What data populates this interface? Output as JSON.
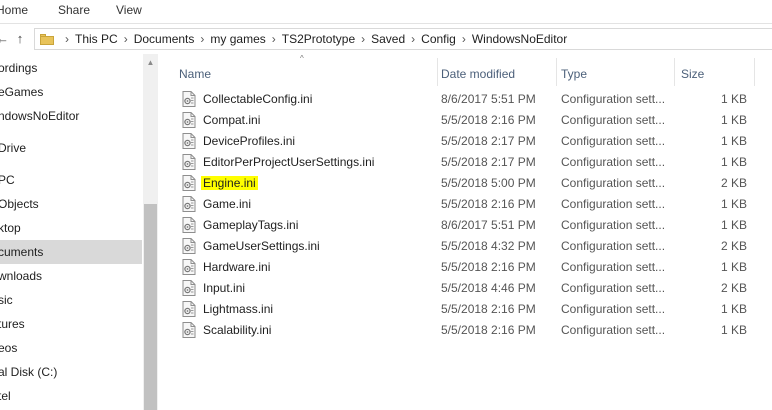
{
  "ribbon": {
    "tabs": [
      "Home",
      "Share",
      "View"
    ]
  },
  "nav": {
    "back_glyph": "←",
    "up_glyph": "↑"
  },
  "address": {
    "crumbs": [
      "This PC",
      "Documents",
      "my games",
      "TS2Prototype",
      "Saved",
      "Config",
      "WindowsNoEditor"
    ]
  },
  "sidebar": {
    "items": [
      {
        "label": "ordings",
        "selected": false
      },
      {
        "label": "eGames",
        "selected": false
      },
      {
        "label": "ndowsNoEditor",
        "selected": false
      },
      {
        "label": "Drive",
        "selected": false
      },
      {
        "label": "PC",
        "selected": false
      },
      {
        "label": "Objects",
        "selected": false
      },
      {
        "label": "ktop",
        "selected": false
      },
      {
        "label": "cuments",
        "selected": true
      },
      {
        "label": "wnloads",
        "selected": false
      },
      {
        "label": "sic",
        "selected": false
      },
      {
        "label": "tures",
        "selected": false
      },
      {
        "label": "eos",
        "selected": false
      },
      {
        "label": "al Disk (C:)",
        "selected": false
      },
      {
        "label": "tel",
        "selected": false
      }
    ]
  },
  "columns": {
    "name": "Name",
    "date": "Date modified",
    "type": "Type",
    "size": "Size"
  },
  "files": [
    {
      "name": "CollectableConfig.ini",
      "date": "8/6/2017 5:51 PM",
      "type": "Configuration sett...",
      "size": "1 KB",
      "highlighted": false
    },
    {
      "name": "Compat.ini",
      "date": "5/5/2018 2:16 PM",
      "type": "Configuration sett...",
      "size": "1 KB",
      "highlighted": false
    },
    {
      "name": "DeviceProfiles.ini",
      "date": "5/5/2018 2:17 PM",
      "type": "Configuration sett...",
      "size": "1 KB",
      "highlighted": false
    },
    {
      "name": "EditorPerProjectUserSettings.ini",
      "date": "5/5/2018 2:17 PM",
      "type": "Configuration sett...",
      "size": "1 KB",
      "highlighted": false
    },
    {
      "name": "Engine.ini",
      "date": "5/5/2018 5:00 PM",
      "type": "Configuration sett...",
      "size": "2 KB",
      "highlighted": true
    },
    {
      "name": "Game.ini",
      "date": "5/5/2018 2:16 PM",
      "type": "Configuration sett...",
      "size": "1 KB",
      "highlighted": false
    },
    {
      "name": "GameplayTags.ini",
      "date": "8/6/2017 5:51 PM",
      "type": "Configuration sett...",
      "size": "1 KB",
      "highlighted": false
    },
    {
      "name": "GameUserSettings.ini",
      "date": "5/5/2018 4:32 PM",
      "type": "Configuration sett...",
      "size": "2 KB",
      "highlighted": false
    },
    {
      "name": "Hardware.ini",
      "date": "5/5/2018 2:16 PM",
      "type": "Configuration sett...",
      "size": "1 KB",
      "highlighted": false
    },
    {
      "name": "Input.ini",
      "date": "5/5/2018 4:46 PM",
      "type": "Configuration sett...",
      "size": "2 KB",
      "highlighted": false
    },
    {
      "name": "Lightmass.ini",
      "date": "5/5/2018 2:16 PM",
      "type": "Configuration sett...",
      "size": "1 KB",
      "highlighted": false
    },
    {
      "name": "Scalability.ini",
      "date": "5/5/2018 2:16 PM",
      "type": "Configuration sett...",
      "size": "1 KB",
      "highlighted": false
    }
  ],
  "colors": {
    "highlight": "#ffff00",
    "selected_nav": "#d9d9d9",
    "header_text": "#4c607a",
    "folder": "#e8c35a"
  }
}
